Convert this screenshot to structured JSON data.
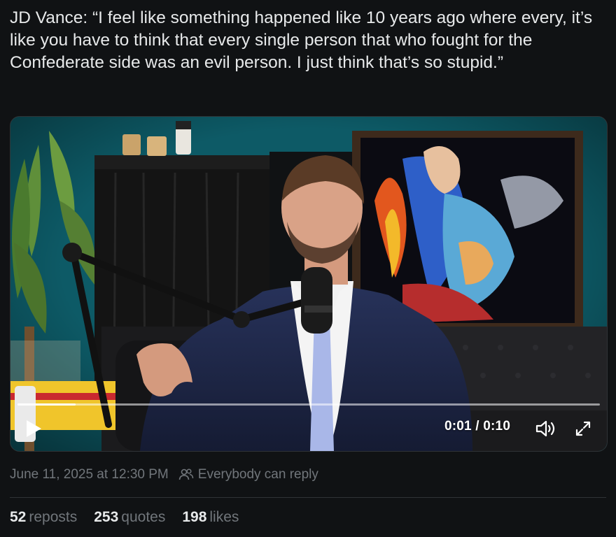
{
  "post": {
    "text": "JD Vance: “I feel like something happened like 10 years ago where every, it’s like you have to think that every single person that who fought for the Confederate side was an evil person. I just think that’s so stupid.”"
  },
  "video": {
    "current_time": "0:01",
    "duration": "0:10",
    "time_display": "0:01 / 0:10",
    "progress": 0.1,
    "play_icon": "play-icon",
    "volume_icon": "volume-icon",
    "fullscreen_icon": "expand-icon"
  },
  "meta": {
    "timestamp": "June 11, 2025 at 12:30 PM",
    "reply_setting": "Everybody can reply",
    "reply_icon": "people-icon"
  },
  "stats": {
    "reposts_count": "52",
    "reposts_label": "reposts",
    "quotes_count": "253",
    "quotes_label": "quotes",
    "likes_count": "198",
    "likes_label": "likes"
  },
  "colors": {
    "background": "#101214",
    "text_primary": "#e7e9ea",
    "text_secondary": "#71767b",
    "divider": "#2f3336"
  }
}
